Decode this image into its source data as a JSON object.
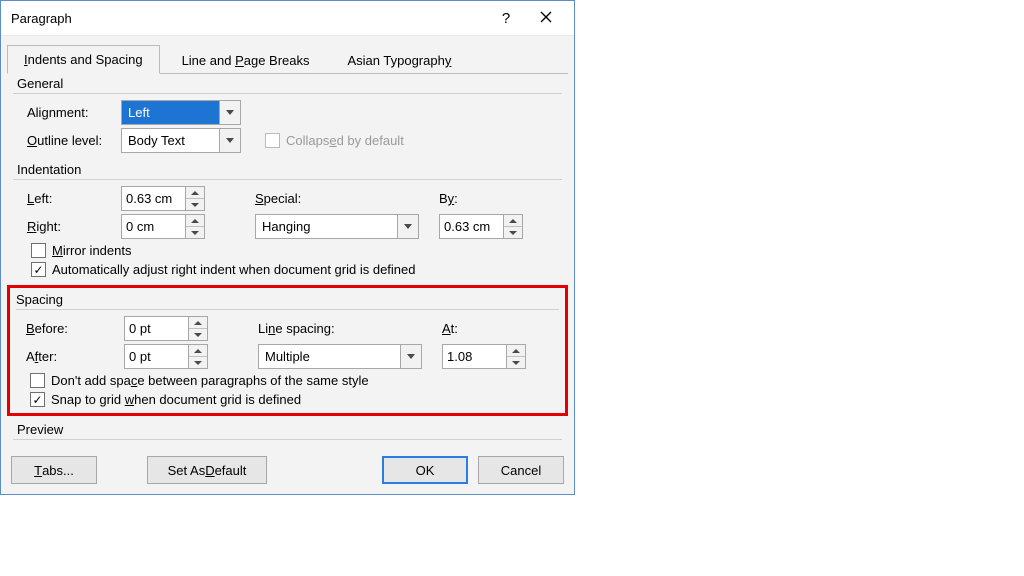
{
  "title": "Paragraph",
  "tabs": {
    "indents_spacing_html": "<span class=\"u\">I</span>ndents and Spacing",
    "line_page_breaks_html": "Line and <span class=\"u\">P</span>age Breaks",
    "asian_html": "Asian Typograph<span class=\"u\">y</span>"
  },
  "general": {
    "title": "General",
    "alignment_label_html": "Ali<span class=\"u\">g</span>nment:",
    "alignment_value": "Left",
    "outline_label_html": "<span class=\"u\">O</span>utline level:",
    "outline_value": "Body Text",
    "collapsed_label_html": "Collaps<span class=\"u\">e</span>d by default"
  },
  "indentation": {
    "title": "Indentation",
    "left_label_html": "<span class=\"u\">L</span>eft:",
    "left_value": "0.63 cm",
    "right_label_html": "<span class=\"u\">R</span>ight:",
    "right_value": "0 cm",
    "special_label_html": "<span class=\"u\">S</span>pecial:",
    "special_value": "Hanging",
    "by_label_html": "B<span class=\"u\">y</span>:",
    "by_value": "0.63 cm",
    "mirror_label_html": "<span class=\"u\">M</span>irror indents",
    "auto_adjust_label_html": "Automatically ad<span class=\"u\">j</span>ust right indent when document grid is defined"
  },
  "spacing": {
    "title": "Spacing",
    "before_label_html": "<span class=\"u\">B</span>efore:",
    "before_value": "0 pt",
    "after_label_html": "A<span class=\"u\">f</span>ter:",
    "after_value": "0 pt",
    "line_spacing_label_html": "Li<span class=\"u\">n</span>e spacing:",
    "line_spacing_value": "Multiple",
    "at_label_html": "<span class=\"u\">A</span>t:",
    "at_value": "1.08",
    "dont_add_label_html": "Don't add spa<span class=\"u\">c</span>e between paragraphs of the same style",
    "snap_label_html": "Snap to grid <span class=\"u\">w</span>hen document grid is defined"
  },
  "preview": {
    "title": "Preview"
  },
  "buttons": {
    "tabs_html": "<span class=\"u\">T</span>abs...",
    "set_default_html": "Set As <span class=\"u\">D</span>efault",
    "ok": "OK",
    "cancel": "Cancel"
  }
}
